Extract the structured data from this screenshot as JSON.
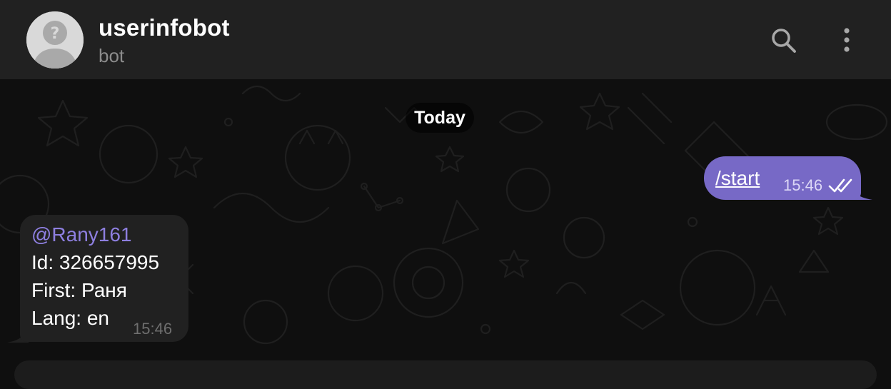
{
  "header": {
    "title": "userinfobot",
    "subtitle": "bot",
    "icons": {
      "avatar": "unknown-user-avatar",
      "search": "search-icon",
      "menu": "more-vertical-icon"
    }
  },
  "chat": {
    "date_separator": "Today",
    "outgoing": {
      "text": "/start",
      "time": "15:46",
      "status_icon": "double-check-icon"
    },
    "incoming": {
      "username": "@Rany161",
      "id_line": "Id: 326657995",
      "first_line": "First: Раня",
      "lang_line": "Lang: en",
      "time": "15:46"
    }
  },
  "colors": {
    "accent": "#7769c6",
    "username": "#8e7fe0",
    "header_bg": "#212121",
    "chat_bg": "#0f0f0f",
    "incoming_bubble": "#212121"
  }
}
